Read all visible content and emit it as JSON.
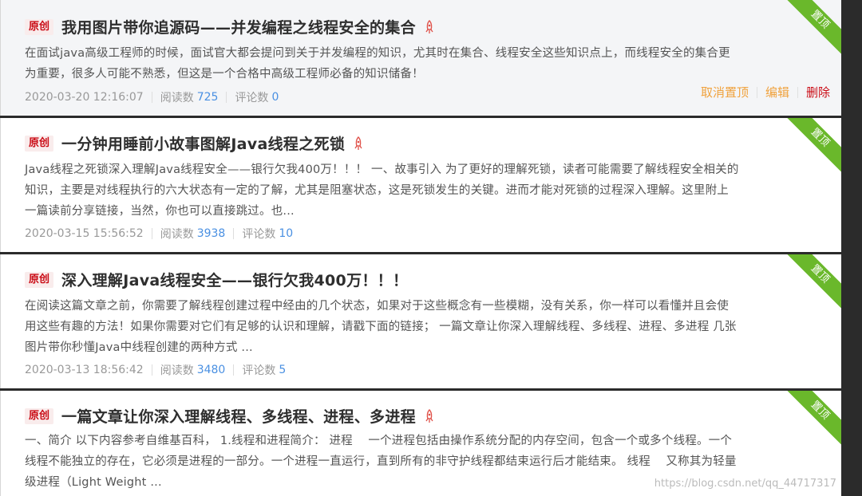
{
  "articles": [
    {
      "badge": "原创",
      "title": "我用图片带你追源码——并发编程之线程安全的集合",
      "ribbon": "置顶",
      "desc1": "在面试java高级工程师的时候，面试官大都会提问到关于并发编程的知识，尤其时在集合、线程安全这些知识点上，而线程安全的集合更",
      "desc2": "为重要，很多人可能不熟悉，但这是一个合格中高级工程师必备的知识储备！",
      "desc3": "",
      "date": "2020-03-20 12:16:07",
      "reads_label": "阅读数",
      "reads": "725",
      "comments_label": "评论数",
      "comments": "0",
      "actions": {
        "unpin": "取消置顶",
        "edit": "编辑",
        "delete": "删除"
      }
    },
    {
      "badge": "原创",
      "title": "一分钟用睡前小故事图解Java线程之死锁",
      "ribbon": "置顶",
      "desc1": "Java线程之死锁深入理解Java线程安全——银行欠我400万！！！ 一、故事引入 为了更好的理解死锁，读者可能需要了解线程安全相关的",
      "desc2": "知识，主要是对线程执行的六大状态有一定的了解，尤其是阻塞状态，这是死锁发生的关键。进而才能对死锁的过程深入理解。这里附上",
      "desc3": "一篇读前分享链接，当然，你也可以直接跳过。也...",
      "date": "2020-03-15 15:56:52",
      "reads_label": "阅读数",
      "reads": "3938",
      "comments_label": "评论数",
      "comments": "10"
    },
    {
      "badge": "原创",
      "title": "深入理解Java线程安全——银行欠我400万！！！",
      "ribbon": "置顶",
      "desc1": "在阅读这篇文章之前，你需要了解线程创建过程中经由的几个状态，如果对于这些概念有一些模糊，没有关系，你一样可以看懂并且会使",
      "desc2": "用这些有趣的方法！如果你需要对它们有足够的认识和理解，请戳下面的链接； 一篇文章让你深入理解线程、多线程、进程、多进程 几张",
      "desc3": "图片带你秒懂Java中线程创建的两种方式 ...",
      "date": "2020-03-13 18:56:42",
      "reads_label": "阅读数",
      "reads": "3480",
      "comments_label": "评论数",
      "comments": "5"
    },
    {
      "badge": "原创",
      "title": "一篇文章让你深入理解线程、多线程、进程、多进程",
      "ribbon": "置顶",
      "desc1": "一、简介 以下内容参考自维基百科， 1.线程和进程简介： 进程　 一个进程包括由操作系统分配的内存空间，包含一个或多个线程。一个",
      "desc2": "线程不能独立的存在，它必须是进程的一部分。一个进程一直运行，直到所有的非守护线程都结束运行后才能结束。 线程　 又称其为轻量",
      "desc3": "级进程（Light Weight ..."
    }
  ],
  "watermark": "https://blog.csdn.net/qq_44717317"
}
